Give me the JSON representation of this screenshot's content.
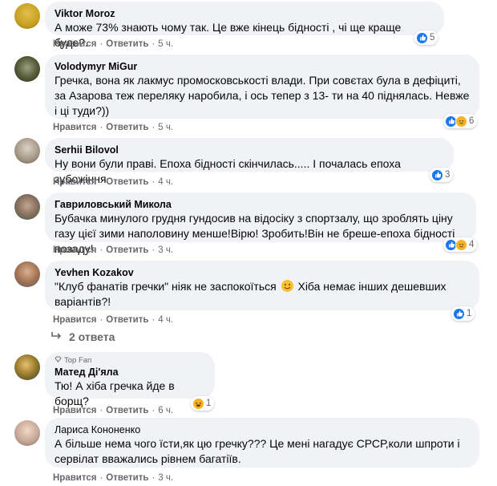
{
  "actions": {
    "like": "Нравится",
    "reply": "Ответить",
    "sep": "·"
  },
  "comments": [
    {
      "author": "Viktor Moroz",
      "text": "А може 73% знають чому так. Це вже кінець бідності , чі ще краще буде?.",
      "time": "5 ч.",
      "reactions": "5",
      "reaction_types": [
        "like"
      ]
    },
    {
      "author": "Volodymyr MiGur",
      "text": "Гречка, вона як лакмус промосковськості влади. При совєтах була в дефіциті, за Азарова теж переляку наробила, і ось тепер з 13- ти на 40 піднялась. Невже і ці туди?))",
      "time": "5 ч.",
      "reactions": "6",
      "reaction_types": [
        "like",
        "sad"
      ]
    },
    {
      "author": "Serhii Bilovol",
      "text": "Ну вони були праві. Епоха бідності скінчилась..... І почалась епоха зубожіння",
      "time": "4 ч.",
      "reactions": "3",
      "reaction_types": [
        "like"
      ]
    },
    {
      "author": "Гавриловський Микола",
      "text": "Бубачка минулого грудня гундосив на відосіку з спортзалу, що зроблять ціну газу цієї зими наполовину менше!Вірю! Зробить!Він не бреше-епоха бідності позаду!",
      "time": "3 ч.",
      "reactions": "4",
      "reaction_types": [
        "like",
        "sad"
      ]
    },
    {
      "author": "Yevhen Kozakov",
      "text_before": "\"Клуб фанатів гречки\" ніяк не заспокоїться",
      "text_after": "Хіба немає інших дешевших варіантів?!",
      "time": "4 ч.",
      "reactions": "1",
      "reaction_types": [
        "like"
      ]
    },
    {
      "author": "Матед Ді'яла",
      "badge": "Top Fan",
      "text": "Тю! А хіба гречка йде в борщ?",
      "time": "6 ч.",
      "reactions": "1",
      "reaction_types": [
        "haha"
      ]
    },
    {
      "author": "Лариса Кононенко",
      "text": "А більше нема чого їсти,як цю гречку??? Це мені нагадує СРСР,коли шпроти і сервілат вважались рівнем багатіїв.",
      "time": "3 ч."
    }
  ],
  "replies_label": "2 ответа"
}
